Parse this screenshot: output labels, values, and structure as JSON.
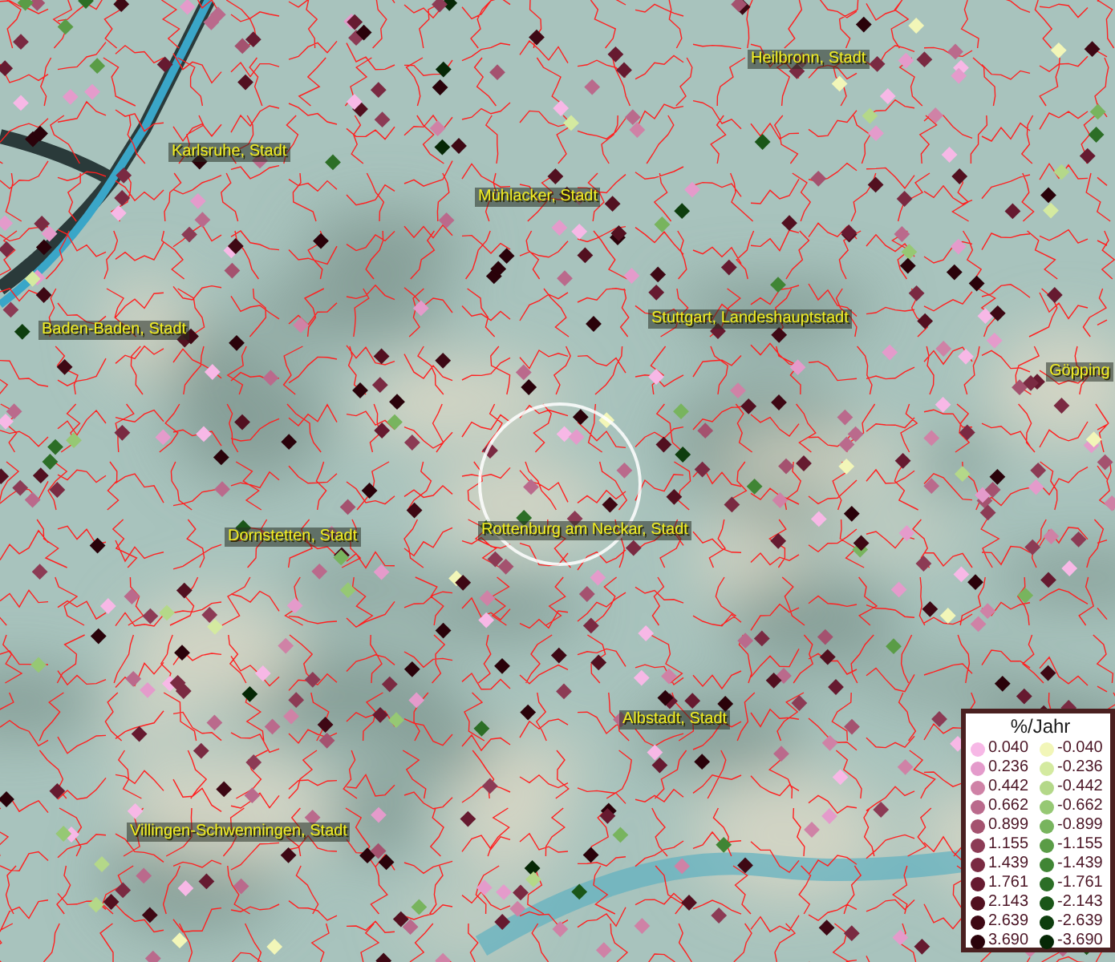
{
  "map": {
    "place_labels": [
      {
        "text": "Heilbronn, Stadt"
      },
      {
        "text": "Karlsruhe, Stadt"
      },
      {
        "text": "Mühlacker, Stadt"
      },
      {
        "text": "Stuttgart, Landeshauptstadt"
      },
      {
        "text": "Baden-Baden, Stadt"
      },
      {
        "text": "Göpping"
      },
      {
        "text": "Dornstetten, Stadt"
      },
      {
        "text": "Rottenburg am Neckar, Stadt"
      },
      {
        "text": "Albstadt, Stadt"
      },
      {
        "text": "Villingen-Schwenningen, Stadt"
      }
    ]
  },
  "legend": {
    "title": "%/Jahr",
    "rows": [
      {
        "positive": {
          "label": "0.040",
          "color": "#f7b8e6"
        },
        "negative": {
          "label": "-0.040",
          "color": "#f2f6b8"
        }
      },
      {
        "positive": {
          "label": "0.236",
          "color": "#e49bcb"
        },
        "negative": {
          "label": "-0.236",
          "color": "#d4eaa0"
        }
      },
      {
        "positive": {
          "label": "0.442",
          "color": "#cf82a6"
        },
        "negative": {
          "label": "-0.442",
          "color": "#b4d889"
        }
      },
      {
        "positive": {
          "label": "0.662",
          "color": "#ba6a8c"
        },
        "negative": {
          "label": "-0.662",
          "color": "#96c874"
        }
      },
      {
        "positive": {
          "label": "0.899",
          "color": "#a4526f"
        },
        "negative": {
          "label": "-0.899",
          "color": "#78b45e"
        }
      },
      {
        "positive": {
          "label": "1.155",
          "color": "#8c3b55"
        },
        "negative": {
          "label": "-1.155",
          "color": "#5a9c46"
        }
      },
      {
        "positive": {
          "label": "1.439",
          "color": "#7a2a42"
        },
        "negative": {
          "label": "-1.439",
          "color": "#408534"
        }
      },
      {
        "positive": {
          "label": "1.761",
          "color": "#661a30"
        },
        "negative": {
          "label": "-1.761",
          "color": "#2c6e26"
        }
      },
      {
        "positive": {
          "label": "2.143",
          "color": "#521020"
        },
        "negative": {
          "label": "-2.143",
          "color": "#1a5618"
        }
      },
      {
        "positive": {
          "label": "2.639",
          "color": "#3e0814"
        },
        "negative": {
          "label": "-2.639",
          "color": "#0e3e0e"
        }
      },
      {
        "positive": {
          "label": "3.690",
          "color": "#2a020a"
        },
        "negative": {
          "label": "-3.690",
          "color": "#062806"
        }
      }
    ]
  }
}
